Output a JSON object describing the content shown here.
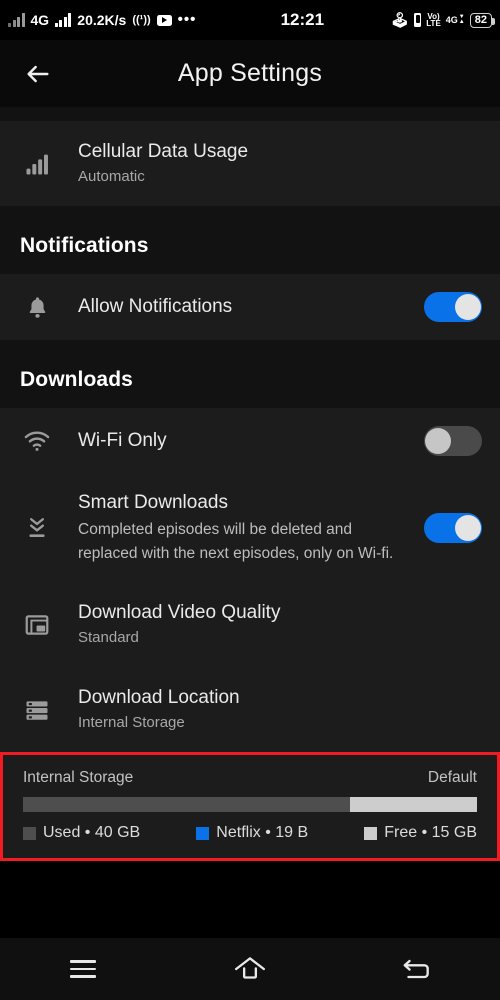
{
  "status_bar": {
    "network_type": "4G",
    "data_speed": "20.2K/s",
    "cast_icon": "cast-icon",
    "youtube_icon": "youtube-icon",
    "more_icon": "ellipsis-icon",
    "clock": "12:21",
    "bluetooth_icon": "bluetooth-icon",
    "vibrate_icon": "vibrate-icon",
    "volte_top": "Vo)",
    "volte_bottom": "LTE",
    "sim_network": "4G",
    "sim_index": "2",
    "battery_level": "82"
  },
  "header": {
    "back_icon": "back-arrow-icon",
    "title": "App Settings"
  },
  "rows": {
    "cellular": {
      "icon": "signal-bars-icon",
      "title": "Cellular Data Usage",
      "subtitle": "Automatic"
    },
    "allow_notifications": {
      "icon": "bell-icon",
      "title": "Allow Notifications",
      "toggle_state": "on"
    },
    "wifi_only": {
      "icon": "wifi-icon",
      "title": "Wi-Fi Only",
      "toggle_state": "off"
    },
    "smart_downloads": {
      "icon": "download-chevrons-icon",
      "title": "Smart Downloads",
      "description": "Completed episodes will be deleted and replaced with the next episodes, only on Wi-fi.",
      "toggle_state": "on"
    },
    "video_quality": {
      "icon": "video-layout-icon",
      "title": "Download Video Quality",
      "subtitle": "Standard"
    },
    "download_location": {
      "icon": "storage-server-icon",
      "title": "Download Location",
      "subtitle": "Internal Storage"
    }
  },
  "sections": {
    "notifications": "Notifications",
    "downloads": "Downloads"
  },
  "storage": {
    "label": "Internal Storage",
    "badge": "Default",
    "legend": [
      {
        "name": "Used",
        "value": "40 GB",
        "text": "Used • 40 GB",
        "color": "#4e4e4e",
        "percent": 72
      },
      {
        "name": "Netflix",
        "value": "19 B",
        "text": "Netflix • 19 B",
        "color": "#0a72e8",
        "percent": 0
      },
      {
        "name": "Free",
        "value": "15 GB",
        "text": "Free • 15 GB",
        "color": "#cdcdcd",
        "percent": 28
      }
    ]
  },
  "navbar": {
    "menu_icon": "menu-recents-icon",
    "home_icon": "home-icon",
    "back_icon": "back-nav-icon"
  },
  "colors": {
    "accent_blue": "#0a72e8",
    "highlight_red": "#f31b23",
    "row_bg": "#1c1c1c",
    "page_bg": "#121212"
  }
}
